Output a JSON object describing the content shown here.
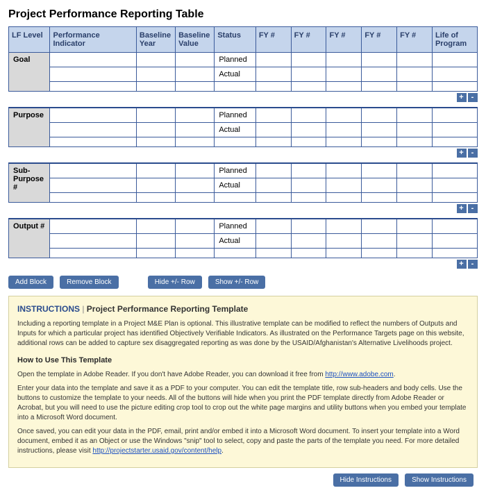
{
  "title": "Project Performance Reporting Table",
  "headers": {
    "lf": "LF Level",
    "pi": "Performance Indicator",
    "by": "Baseline Year",
    "bv": "Baseline Value",
    "st": "Status",
    "fy": "FY #",
    "lp": "Life of Program"
  },
  "status": {
    "planned": "Planned",
    "actual": "Actual"
  },
  "sections": [
    {
      "label": "Goal"
    },
    {
      "label": "Purpose"
    },
    {
      "label": "Sub-Purpose #"
    },
    {
      "label": "Output #"
    }
  ],
  "pm": {
    "plus": "+",
    "minus": "-"
  },
  "buttons": {
    "add_block": "Add Block",
    "remove_block": "Remove Block",
    "hide_row": "Hide +/- Row",
    "show_row": "Show +/- Row",
    "hide_instr": "Hide Instructions",
    "show_instr": "Show Instructions"
  },
  "instructions": {
    "heading_prefix": "INSTRUCTIONS",
    "heading_sep": " | ",
    "heading_title": "Project Performance Reporting Template",
    "p1": "Including a reporting template in a Project M&E Plan is optional. This illustrative template can be modified to reflect the numbers of Outputs and Inputs for which a particular project has identified Objectively Verifiable Indicators. As illustrated on the Performance Targets page on this website, additional rows can be added to capture sex disaggregated reporting as was done by the USAID/Afghanistan's Alternative Livelihoods project.",
    "howto": "How to Use This Template",
    "p2a": "Open the template in Adobe Reader. If you don't have Adobe Reader, you can download it free from ",
    "p2link": "http://www.adobe.com",
    "p2b": ".",
    "p3": "Enter your data into the template and save it as a PDF to your computer. You can edit the template title, row sub-headers and body cells. Use the buttons to customize the template to your needs. All of the buttons will hide when you print the PDF template directly from Adobe Reader or Acrobat, but you will need to use the picture editing crop tool to crop out the white page margins and utility buttons when you embed your template into a Microsoft Word document.",
    "p4a": "Once saved, you can edit your data in the PDF, email, print and/or embed it into a Microsoft Word document. To insert your template into a Word document, embed it as an Object or use the Windows \"snip\" tool to select, copy and paste the parts of the template you need. For more detailed instructions, please visit ",
    "p4link": "http://projectstarter.usaid.gov/content/help",
    "p4b": "."
  }
}
